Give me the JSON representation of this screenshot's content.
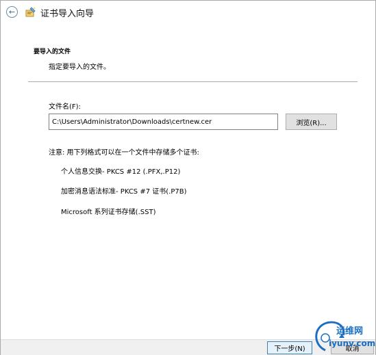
{
  "window": {
    "title": "证书导入向导"
  },
  "page": {
    "heading": "要导入的文件",
    "subheading": "指定要导入的文件。"
  },
  "file": {
    "label": "文件名(F):",
    "value": "C:\\Users\\Administrator\\Downloads\\certnew.cer",
    "browse_label": "浏览(R)..."
  },
  "note": {
    "text": "注意: 用下列格式可以在一个文件中存储多个证书:",
    "formats": [
      "个人信息交换- PKCS #12 (.PFX,.P12)",
      "加密消息语法标准- PKCS #7 证书(.P7B)",
      "Microsoft 系列证书存储(.SST)"
    ]
  },
  "footer": {
    "next_label": "下一步(N)",
    "cancel_label": "取消"
  },
  "watermark": {
    "line1": "运维网",
    "line2": "iyunv.com"
  },
  "icons": {
    "back": "back-arrow-icon",
    "wizard": "certificate-wizard-icon"
  },
  "colors": {
    "accent": "#3c7fb1",
    "divider": "#a9a9a9",
    "watermark": "#1a6fc4"
  }
}
